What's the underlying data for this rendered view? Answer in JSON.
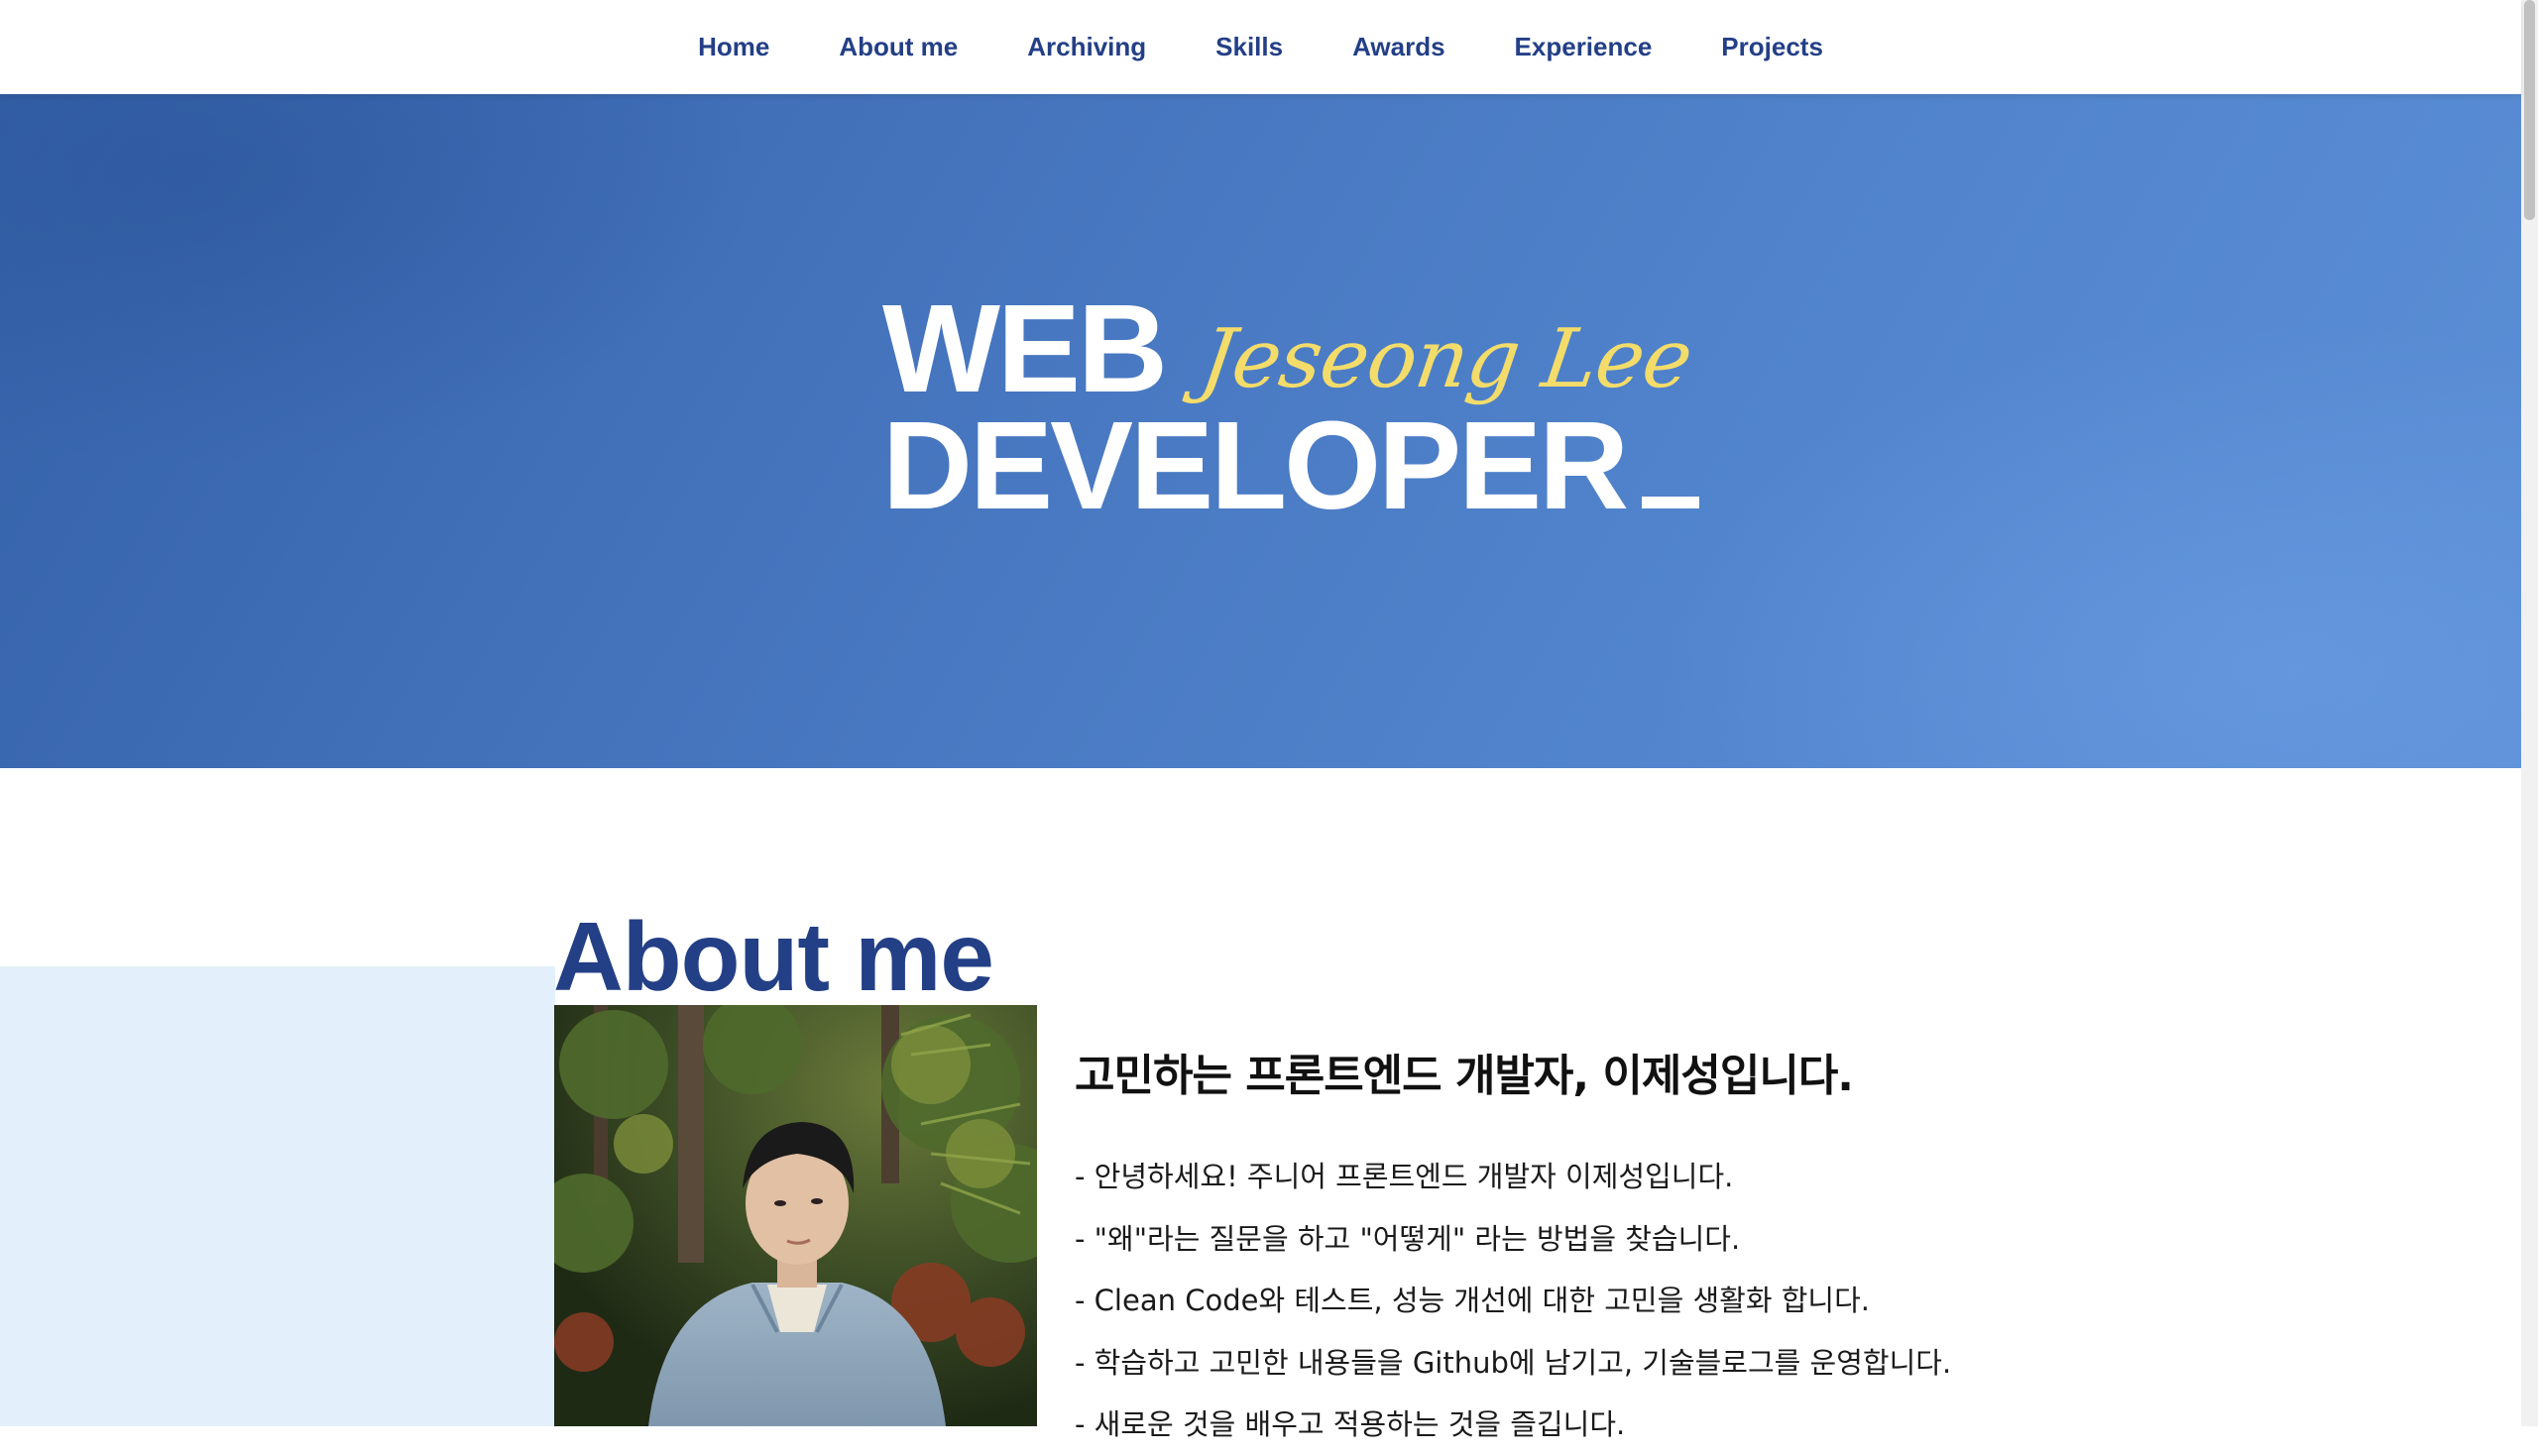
{
  "nav": {
    "items": [
      {
        "label": "Home"
      },
      {
        "label": "About me"
      },
      {
        "label": "Archiving"
      },
      {
        "label": "Skills"
      },
      {
        "label": "Awards"
      },
      {
        "label": "Experience"
      },
      {
        "label": "Projects"
      }
    ]
  },
  "hero": {
    "line1": "WEB",
    "line2": "DEVELOPER",
    "signature": "Jeseong Lee"
  },
  "about": {
    "heading": "About me",
    "subtitle": "고민하는 프론트엔드 개발자, 이제성입니다.",
    "bullets": [
      "- 안녕하세요! 주니어 프론트엔드 개발자 이제성입니다.",
      "- \"왜\"라는 질문을 하고 \"어떻게\" 라는 방법을 찾습니다.",
      "- Clean Code와 테스트, 성능 개선에 대한 고민을 생활화 합니다.",
      "- 학습하고 고민한 내용들을 Github에 남기고, 기술블로그를 운영합니다.",
      "- 새로운 것을 배우고 적용하는 것을 즐깁니다."
    ]
  },
  "colors": {
    "nav_text": "#233f86",
    "hero_bg": "#4574bd",
    "signature": "#f3dc6a",
    "about_heading": "#233f86",
    "about_bg": "#e3f0fb"
  }
}
